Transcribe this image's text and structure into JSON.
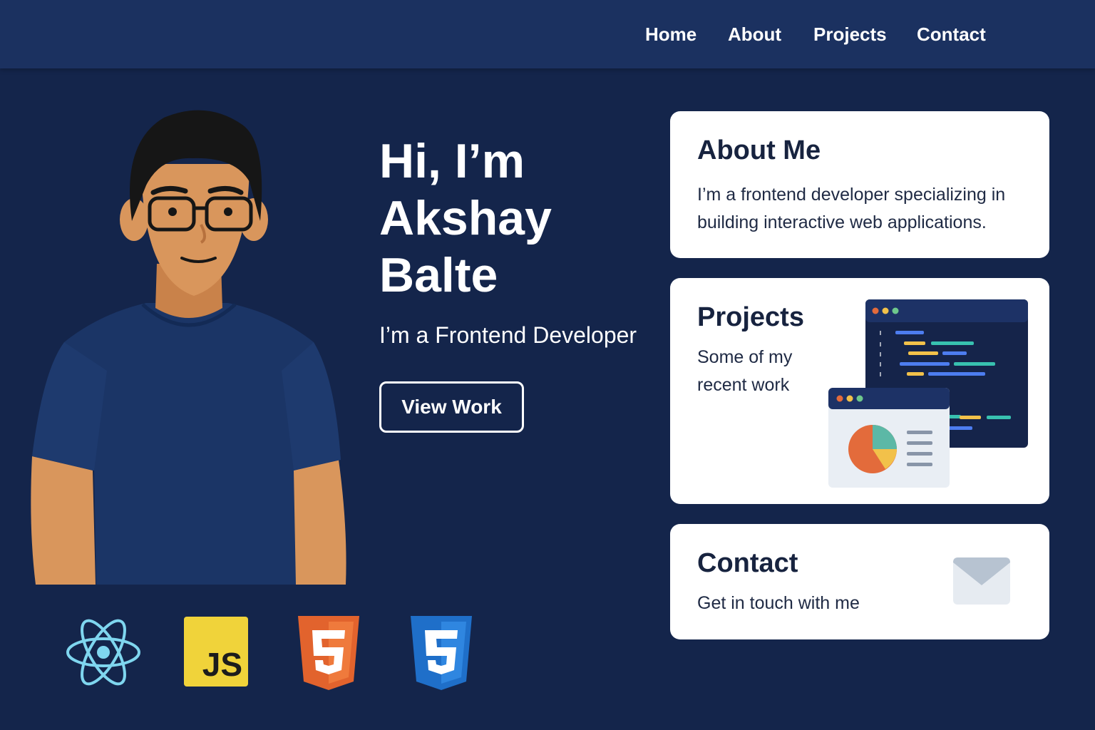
{
  "nav": {
    "items": [
      {
        "label": "Home"
      },
      {
        "label": "About"
      },
      {
        "label": "Projects"
      },
      {
        "label": "Contact"
      }
    ]
  },
  "hero": {
    "title_lines": [
      "Hi, I’m",
      "Akshay",
      "Balte"
    ],
    "subtitle": "I’m a Frontend Developer",
    "cta_label": "View Work"
  },
  "tech": {
    "icons": [
      "react-icon",
      "javascript-icon",
      "html5-icon",
      "css3-icon"
    ],
    "js_label": "JS"
  },
  "cards": {
    "about": {
      "title": "About Me",
      "text_lines": [
        "I’m a frontend developer specializing in",
        "building interactive web applications."
      ]
    },
    "projects": {
      "title": "Projects",
      "text_lines": [
        "Some of my",
        "recent work"
      ],
      "illustration": "code-editor-and-chart-window"
    },
    "contact": {
      "title": "Contact",
      "text": "Get in touch with me",
      "icon": "envelope-icon"
    }
  },
  "colors": {
    "page_bg": "#14254b",
    "nav_bg": "#1b3160",
    "card_bg": "#ffffff",
    "card_text": "#17233f"
  }
}
